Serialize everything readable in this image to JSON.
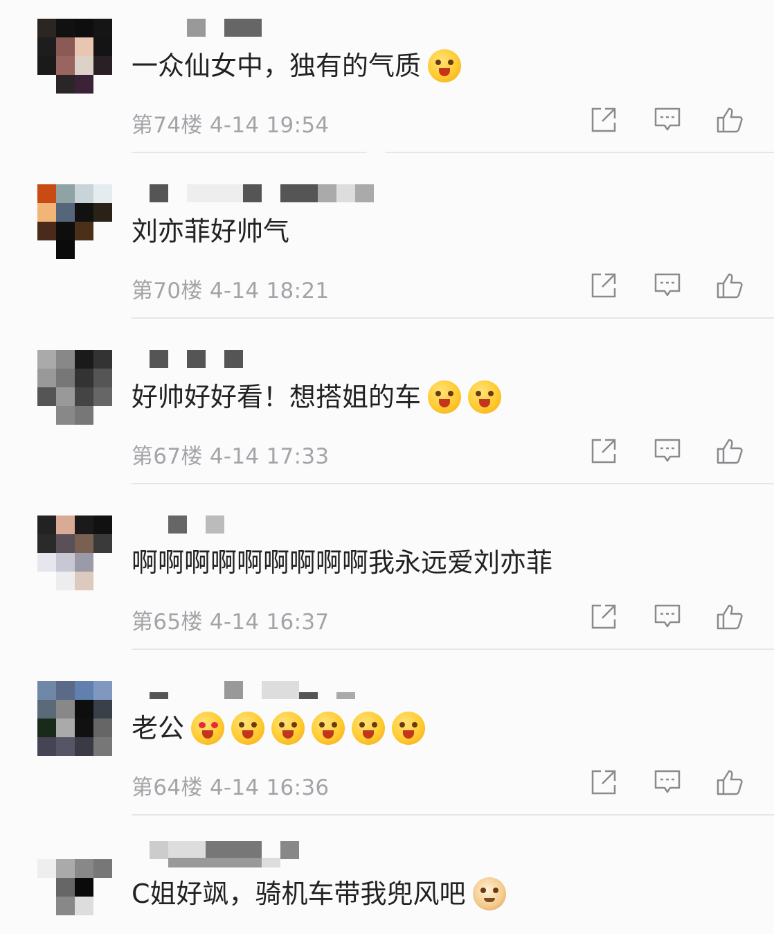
{
  "comments": [
    {
      "text": "一众仙女中，独有的气质",
      "emojis": [
        "dizzy-face"
      ],
      "floor": "第74楼",
      "date": "4-14",
      "time": "19:54"
    },
    {
      "text": "刘亦菲好帅气",
      "emojis": [],
      "floor": "第70楼",
      "date": "4-14",
      "time": "18:21"
    },
    {
      "text": "好帅好好看！想搭姐的车",
      "emojis": [
        "star-struck",
        "star-struck"
      ],
      "floor": "第67楼",
      "date": "4-14",
      "time": "17:33"
    },
    {
      "text": "啊啊啊啊啊啊啊啊啊我永远爱刘亦菲",
      "emojis": [],
      "floor": "第65楼",
      "date": "4-14",
      "time": "16:37"
    },
    {
      "text": "老公",
      "emojis": [
        "heart-eyes",
        "awe-face",
        "awe-face",
        "awe-face",
        "awe-face",
        "awe-face"
      ],
      "floor": "第64楼",
      "date": "4-14",
      "time": "16:36"
    },
    {
      "text": "C姐好飒，骑机车带我兜风吧",
      "emojis": [
        "doge-face"
      ]
    }
  ],
  "icons": {
    "share": "share-icon",
    "reply": "comment-icon",
    "like": "thumbs-up-icon"
  },
  "colors": {
    "text": "#222222",
    "meta": "#a4a4a8",
    "icon": "#8a8a8e",
    "divider": "#e6e6e8"
  }
}
